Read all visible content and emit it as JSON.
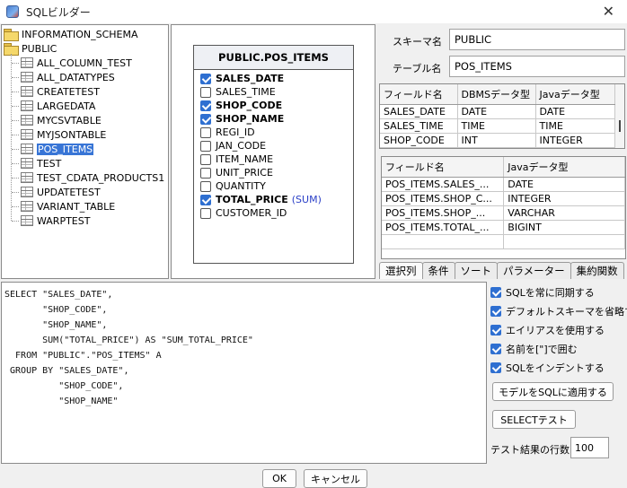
{
  "window": {
    "title": "SQLビルダー",
    "close_glyph": "✕"
  },
  "tree": {
    "schemas": [
      {
        "label": "INFORMATION_SCHEMA"
      },
      {
        "label": "PUBLIC"
      }
    ],
    "tables": [
      "ALL_COLUMN_TEST",
      "ALL_DATATYPES",
      "CREATETEST",
      "LARGEDATA",
      "MYCSVTABLE",
      "MYJSONTABLE",
      "POS_ITEMS",
      "TEST",
      "TEST_CDATA_PRODUCTS1",
      "UPDATETEST",
      "VARIANT_TABLE",
      "WARPTEST"
    ],
    "selected": "POS_ITEMS"
  },
  "tablebox": {
    "title": "PUBLIC.POS_ITEMS",
    "columns": [
      {
        "name": "SALES_DATE",
        "checked": true,
        "agg": ""
      },
      {
        "name": "SALES_TIME",
        "checked": false,
        "agg": ""
      },
      {
        "name": "SHOP_CODE",
        "checked": true,
        "agg": ""
      },
      {
        "name": "SHOP_NAME",
        "checked": true,
        "agg": ""
      },
      {
        "name": "REGI_ID",
        "checked": false,
        "agg": ""
      },
      {
        "name": "JAN_CODE",
        "checked": false,
        "agg": ""
      },
      {
        "name": "ITEM_NAME",
        "checked": false,
        "agg": ""
      },
      {
        "name": "UNIT_PRICE",
        "checked": false,
        "agg": ""
      },
      {
        "name": "QUANTITY",
        "checked": false,
        "agg": ""
      },
      {
        "name": "TOTAL_PRICE",
        "checked": true,
        "agg": "(SUM)"
      },
      {
        "name": "CUSTOMER_ID",
        "checked": false,
        "agg": ""
      }
    ]
  },
  "info": {
    "schema_label": "スキーマ名",
    "schema_value": "PUBLIC",
    "table_label": "テーブル名",
    "table_value": "POS_ITEMS"
  },
  "fields_grid": {
    "headers": [
      "フィールド名",
      "DBMSデータ型",
      "Javaデータ型"
    ],
    "rows": [
      [
        "SALES_DATE",
        "DATE",
        "DATE"
      ],
      [
        "SALES_TIME",
        "TIME",
        "TIME"
      ],
      [
        "SHOP_CODE",
        "INT",
        "INTEGER"
      ]
    ]
  },
  "selected_grid": {
    "headers": [
      "フィールド名",
      "Javaデータ型"
    ],
    "rows": [
      [
        "POS_ITEMS.SALES_...",
        "DATE"
      ],
      [
        "POS_ITEMS.SHOP_C...",
        "INTEGER"
      ],
      [
        "POS_ITEMS.SHOP_...",
        "VARCHAR"
      ],
      [
        "POS_ITEMS.TOTAL_...",
        "BIGINT"
      ]
    ]
  },
  "tabs": [
    "選択列",
    "条件",
    "ソート",
    "パラメーター",
    "集約関数"
  ],
  "sql": "SELECT \"SALES_DATE\",\n       \"SHOP_CODE\",\n       \"SHOP_NAME\",\n       SUM(\"TOTAL_PRICE\") AS \"SUM_TOTAL_PRICE\"\n  FROM \"PUBLIC\".\"POS_ITEMS\" A\n GROUP BY \"SALES_DATE\",\n          \"SHOP_CODE\",\n          \"SHOP_NAME\"",
  "options": [
    {
      "label": "SQLを常に同期する",
      "checked": true
    },
    {
      "label": "デフォルトスキーマを省略する",
      "checked": true
    },
    {
      "label": "エイリアスを使用する",
      "checked": true
    },
    {
      "label": "名前を[\"]で囲む",
      "checked": true
    },
    {
      "label": "SQLをインデントする",
      "checked": true
    }
  ],
  "buttons": {
    "apply_model": "モデルをSQLに適用する",
    "select_test": "SELECTテスト",
    "ok": "OK",
    "cancel": "キャンセル"
  },
  "test_rows": {
    "label": "テスト結果の行数",
    "value": "100"
  }
}
